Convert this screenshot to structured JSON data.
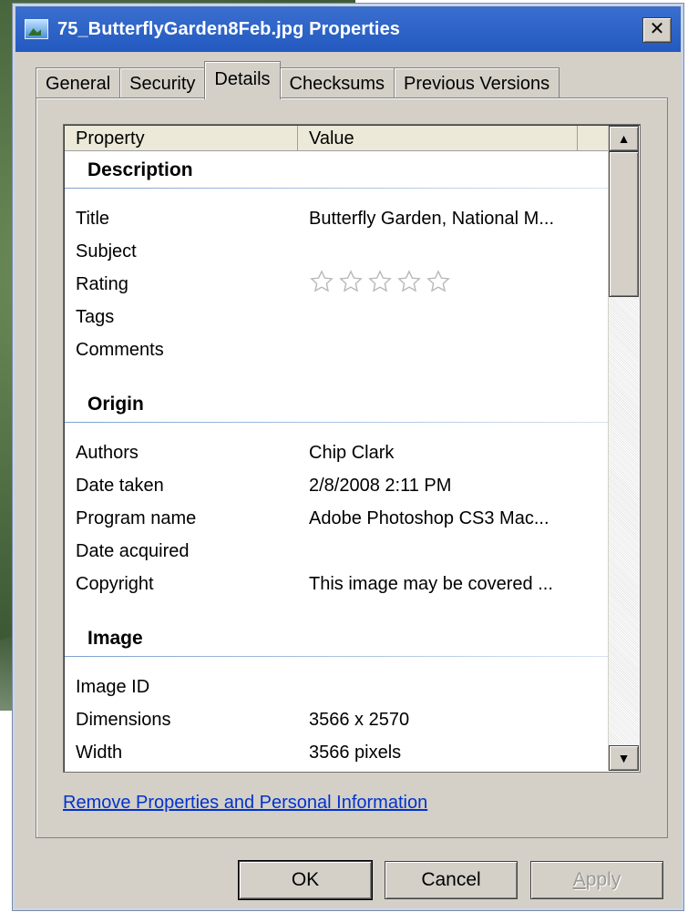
{
  "window": {
    "title": "75_ButterflyGarden8Feb.jpg Properties",
    "close_glyph": "✕"
  },
  "tabs": [
    {
      "label": "General",
      "active": false
    },
    {
      "label": "Security",
      "active": false
    },
    {
      "label": "Details",
      "active": true
    },
    {
      "label": "Checksums",
      "active": false
    },
    {
      "label": "Previous Versions",
      "active": false
    }
  ],
  "details": {
    "columns": {
      "property": "Property",
      "value": "Value"
    },
    "groups": [
      {
        "name": "Description",
        "rows": [
          {
            "property": "Title",
            "value": "Butterfly Garden, National M..."
          },
          {
            "property": "Subject",
            "value": ""
          },
          {
            "property": "Rating",
            "value": "",
            "rating": 0,
            "rating_max": 5
          },
          {
            "property": "Tags",
            "value": ""
          },
          {
            "property": "Comments",
            "value": ""
          }
        ]
      },
      {
        "name": "Origin",
        "rows": [
          {
            "property": "Authors",
            "value": "Chip Clark"
          },
          {
            "property": "Date taken",
            "value": "2/8/2008 2:11 PM"
          },
          {
            "property": "Program name",
            "value": "Adobe Photoshop CS3 Mac..."
          },
          {
            "property": "Date acquired",
            "value": ""
          },
          {
            "property": "Copyright",
            "value": "This image may be covered ..."
          }
        ]
      },
      {
        "name": "Image",
        "rows": [
          {
            "property": "Image ID",
            "value": ""
          },
          {
            "property": "Dimensions",
            "value": "3566 x 2570"
          },
          {
            "property": "Width",
            "value": "3566 pixels"
          }
        ]
      }
    ],
    "scroll_up_glyph": "▲",
    "scroll_down_glyph": "▼"
  },
  "link": {
    "remove_properties": "Remove Properties and Personal Information"
  },
  "buttons": {
    "ok": "OK",
    "cancel": "Cancel",
    "apply_first": "A",
    "apply_rest": "pply"
  },
  "colors": {
    "titlebar": "#235ac0",
    "link": "#0033cc",
    "dialog": "#d4d0c8"
  },
  "icons": {
    "title": "image-file-icon",
    "rating": "star-outline-icon"
  }
}
